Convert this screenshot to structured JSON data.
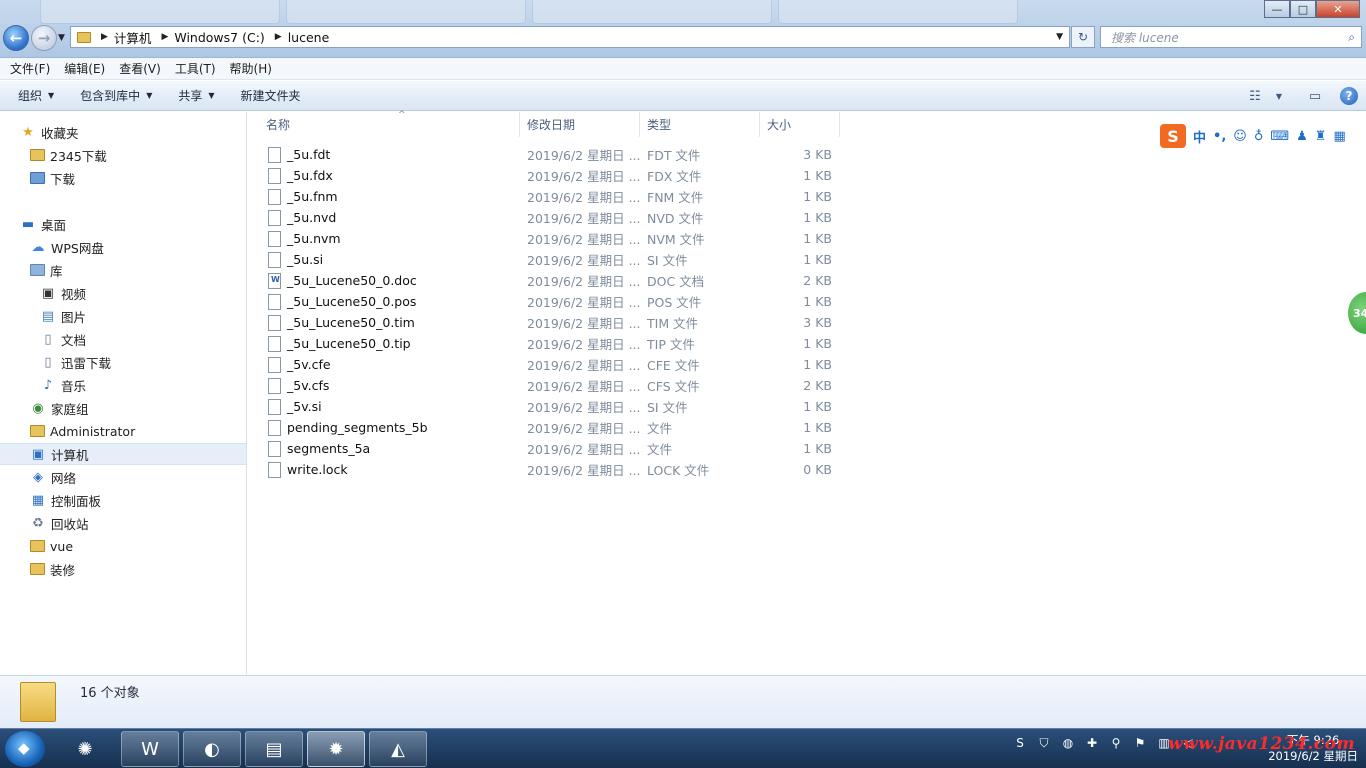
{
  "window": {
    "min_label": "—",
    "max_label": "□",
    "close_label": "✕"
  },
  "nav": {
    "back_glyph": "←",
    "forward_glyph": "→",
    "dropdown_glyph": "▼"
  },
  "address": {
    "segments": [
      "计算机",
      "Windows7 (C:)",
      "lucene"
    ],
    "separator": "▶",
    "dropdown_glyph": "▼",
    "refresh_glyph": "↻"
  },
  "search": {
    "placeholder": "搜索 lucene",
    "icon": "search-icon"
  },
  "menu": [
    "文件(F)",
    "编辑(E)",
    "查看(V)",
    "工具(T)",
    "帮助(H)"
  ],
  "toolbar": {
    "organize": "组织",
    "include_library": "包含到库中",
    "share": "共享",
    "new_folder": "新建文件夹",
    "caret": "▼",
    "help_glyph": "?"
  },
  "sidebar": {
    "favorites": "收藏夹",
    "fav_items": [
      "2345下载",
      "下载"
    ],
    "desktop": "桌面",
    "wps": "WPS网盘",
    "library": "库",
    "library_items": [
      "视频",
      "图片",
      "文档",
      "迅雷下载",
      "音乐"
    ],
    "homegroup": "家庭组",
    "administrator": "Administrator",
    "computer": "计算机",
    "network": "网络",
    "control_panel": "控制面板",
    "recycle": "回收站",
    "extra_folders": [
      "vue",
      "装修"
    ]
  },
  "columns": {
    "name": "名称",
    "modified": "修改日期",
    "type": "类型",
    "size": "大小",
    "sort_glyph": "^"
  },
  "files": [
    {
      "name": "_5u.fdt",
      "date": "2019/6/2 星期日 ...",
      "type": "FDT 文件",
      "size": "3 KB"
    },
    {
      "name": "_5u.fdx",
      "date": "2019/6/2 星期日 ...",
      "type": "FDX 文件",
      "size": "1 KB"
    },
    {
      "name": "_5u.fnm",
      "date": "2019/6/2 星期日 ...",
      "type": "FNM 文件",
      "size": "1 KB"
    },
    {
      "name": "_5u.nvd",
      "date": "2019/6/2 星期日 ...",
      "type": "NVD 文件",
      "size": "1 KB"
    },
    {
      "name": "_5u.nvm",
      "date": "2019/6/2 星期日 ...",
      "type": "NVM 文件",
      "size": "1 KB"
    },
    {
      "name": "_5u.si",
      "date": "2019/6/2 星期日 ...",
      "type": "SI 文件",
      "size": "1 KB"
    },
    {
      "name": "_5u_Lucene50_0.doc",
      "date": "2019/6/2 星期日 ...",
      "type": "DOC 文档",
      "size": "2 KB"
    },
    {
      "name": "_5u_Lucene50_0.pos",
      "date": "2019/6/2 星期日 ...",
      "type": "POS 文件",
      "size": "1 KB"
    },
    {
      "name": "_5u_Lucene50_0.tim",
      "date": "2019/6/2 星期日 ...",
      "type": "TIM 文件",
      "size": "3 KB"
    },
    {
      "name": "_5u_Lucene50_0.tip",
      "date": "2019/6/2 星期日 ...",
      "type": "TIP 文件",
      "size": "1 KB"
    },
    {
      "name": "_5v.cfe",
      "date": "2019/6/2 星期日 ...",
      "type": "CFE 文件",
      "size": "1 KB"
    },
    {
      "name": "_5v.cfs",
      "date": "2019/6/2 星期日 ...",
      "type": "CFS 文件",
      "size": "2 KB"
    },
    {
      "name": "_5v.si",
      "date": "2019/6/2 星期日 ...",
      "type": "SI 文件",
      "size": "1 KB"
    },
    {
      "name": "pending_segments_5b",
      "date": "2019/6/2 星期日 ...",
      "type": "文件",
      "size": "1 KB"
    },
    {
      "name": "segments_5a",
      "date": "2019/6/2 星期日 ...",
      "type": "文件",
      "size": "1 KB"
    },
    {
      "name": "write.lock",
      "date": "2019/6/2 星期日 ...",
      "type": "LOCK 文件",
      "size": "0 KB"
    }
  ],
  "ime": {
    "logo": "S",
    "mode": "中",
    "punct": "•,",
    "icons": [
      "smiley-icon",
      "mic-icon",
      "keyboard-icon",
      "user-icon",
      "shirt-icon",
      "grid-icon"
    ]
  },
  "side_badge": "34",
  "status": {
    "count": "16 个对象"
  },
  "taskbar": {
    "time": "下午 9:26",
    "date": "2019/6/2 星期日",
    "watermark": "www.java1234.com",
    "apps": [
      "360-browser-icon",
      "wps-icon",
      "browser-icon",
      "explorer-icon",
      "eclipse-jee-icon",
      "mysql-dolphin-icon"
    ]
  }
}
